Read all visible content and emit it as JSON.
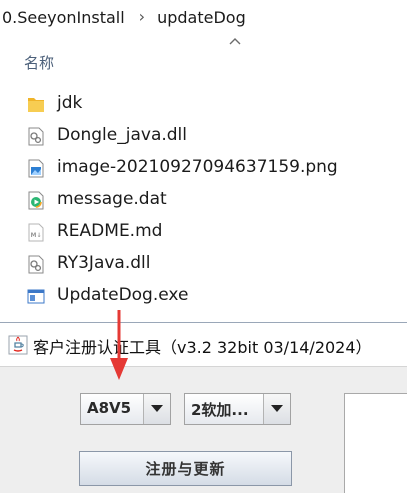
{
  "explorer": {
    "breadcrumb": [
      "0.SeeyonInstall",
      "updateDog"
    ],
    "column_header": "名称",
    "files": [
      {
        "name": "jdk",
        "icon": "folder-icon"
      },
      {
        "name": "Dongle_java.dll",
        "icon": "dll-file-icon"
      },
      {
        "name": "image-20210927094637159.png",
        "icon": "png-image-icon"
      },
      {
        "name": "message.dat",
        "icon": "media-file-icon"
      },
      {
        "name": "README.md",
        "icon": "markdown-file-icon"
      },
      {
        "name": "RY3Java.dll",
        "icon": "dll-file-icon"
      },
      {
        "name": "UpdateDog.exe",
        "icon": "exe-app-icon"
      }
    ]
  },
  "tool": {
    "title": "客户注册认证工具（v3.2 32bit 03/14/2024）",
    "version_select": "A8V5",
    "mode_select": "2软加...",
    "register_button": "注册与更新"
  },
  "colors": {
    "annotation_arrow": "#e53935",
    "folder": "#f5c342",
    "window_bg": "#eeeeee"
  }
}
